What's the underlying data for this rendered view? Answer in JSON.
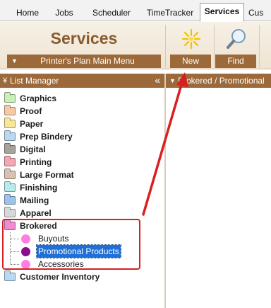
{
  "tabs": [
    {
      "label": "Home"
    },
    {
      "label": "Jobs"
    },
    {
      "label": "Scheduler"
    },
    {
      "label": "TimeTracker"
    },
    {
      "label": "Services",
      "active": true
    },
    {
      "label": "Cus"
    }
  ],
  "toolbar": {
    "title": "Services",
    "menu_label": "Printer's Plan Main Menu",
    "new_label": "New",
    "find_label": "Find"
  },
  "list_manager": {
    "header": "List Manager",
    "collapse_glyph": "«",
    "folders": [
      {
        "label": "Graphics",
        "color": "#c8f0b8"
      },
      {
        "label": "Proof",
        "color": "#f6c9a6"
      },
      {
        "label": "Paper",
        "color": "#f7e79a"
      },
      {
        "label": "Prep Bindery",
        "color": "#b9d8f2"
      },
      {
        "label": "Digital",
        "color": "#a7a29a"
      },
      {
        "label": "Printing",
        "color": "#f2a7b3"
      },
      {
        "label": "Large Format",
        "color": "#d8c2b0"
      },
      {
        "label": "Finishing",
        "color": "#b8ecec"
      },
      {
        "label": "Mailing",
        "color": "#9cc4ea"
      },
      {
        "label": "Apparel",
        "color": "#d8d8d8"
      }
    ],
    "brokered": {
      "label": "Brokered",
      "color": "#f28ad2",
      "children": [
        {
          "label": "Buyouts",
          "color": "#ff7fe0",
          "selected": false
        },
        {
          "label": "Promotional Products",
          "color": "#8a0f8a",
          "selected": true
        },
        {
          "label": "Accessories",
          "color": "#ff7fe0",
          "selected": false
        }
      ]
    },
    "after": [
      {
        "label": "Customer Inventory",
        "color": "#b9d8f2"
      }
    ]
  },
  "right_panel": {
    "header": "Brokered / Promotional"
  },
  "colors": {
    "accent": "#9c6a3a",
    "annotation": "#d82020",
    "selection": "#1f6fd6"
  }
}
